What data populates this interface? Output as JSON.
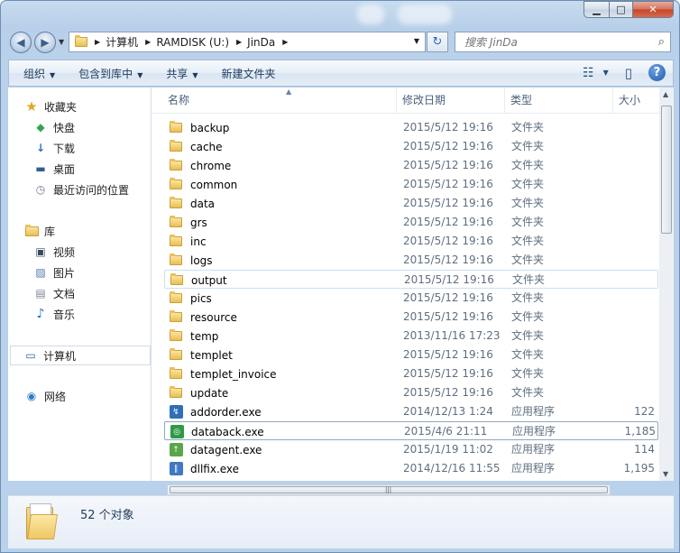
{
  "window": {
    "min_symbol": "▁",
    "max_symbol": "□",
    "close_symbol": "✕"
  },
  "nav": {
    "back_symbol": "◀",
    "forward_symbol": "▶",
    "drop_symbol": "▼",
    "breadcrumb": [
      "计算机",
      "RAMDISK (U:)",
      "JinDa"
    ],
    "breadcrumb_sep": "▶",
    "refresh_symbol": "↻",
    "search_placeholder": "搜索 JinDa",
    "search_icon": "⌕"
  },
  "toolbar": {
    "organize": "组织",
    "include_in_library": "包含到库中",
    "share": "共享",
    "new_folder": "新建文件夹",
    "arrow": "▼",
    "view_icon": "☷",
    "pane_icon": "▯",
    "help": "?"
  },
  "sidebar": {
    "favorites": {
      "label": "收藏夹",
      "icon": "★",
      "items": [
        {
          "label": "快盘",
          "icon": "◆"
        },
        {
          "label": "下载",
          "icon": "↓"
        },
        {
          "label": "桌面",
          "icon": "▬"
        },
        {
          "label": "最近访问的位置",
          "icon": "◷"
        }
      ]
    },
    "libraries": {
      "label": "库",
      "items": [
        {
          "label": "视频",
          "icon": "▣"
        },
        {
          "label": "图片",
          "icon": "▨"
        },
        {
          "label": "文档",
          "icon": "▤"
        },
        {
          "label": "音乐",
          "icon": "♪"
        }
      ]
    },
    "computer": {
      "label": "计算机",
      "icon": "▭"
    },
    "network": {
      "label": "网络",
      "icon": "◉"
    }
  },
  "columns": {
    "name": "名称",
    "date": "修改日期",
    "type": "类型",
    "size": "大小",
    "sort_arrow": "▲"
  },
  "files": [
    {
      "name": "backup",
      "date": "2015/5/12 19:16",
      "type": "文件夹",
      "size": "",
      "kind": "folder"
    },
    {
      "name": "cache",
      "date": "2015/5/12 19:16",
      "type": "文件夹",
      "size": "",
      "kind": "folder"
    },
    {
      "name": "chrome",
      "date": "2015/5/12 19:16",
      "type": "文件夹",
      "size": "",
      "kind": "folder"
    },
    {
      "name": "common",
      "date": "2015/5/12 19:16",
      "type": "文件夹",
      "size": "",
      "kind": "folder"
    },
    {
      "name": "data",
      "date": "2015/5/12 19:16",
      "type": "文件夹",
      "size": "",
      "kind": "folder"
    },
    {
      "name": "grs",
      "date": "2015/5/12 19:16",
      "type": "文件夹",
      "size": "",
      "kind": "folder"
    },
    {
      "name": "inc",
      "date": "2015/5/12 19:16",
      "type": "文件夹",
      "size": "",
      "kind": "folder"
    },
    {
      "name": "logs",
      "date": "2015/5/12 19:16",
      "type": "文件夹",
      "size": "",
      "kind": "folder"
    },
    {
      "name": "output",
      "date": "2015/5/12 19:16",
      "type": "文件夹",
      "size": "",
      "kind": "folder",
      "state": "hl"
    },
    {
      "name": "pics",
      "date": "2015/5/12 19:16",
      "type": "文件夹",
      "size": "",
      "kind": "folder"
    },
    {
      "name": "resource",
      "date": "2015/5/12 19:16",
      "type": "文件夹",
      "size": "",
      "kind": "folder"
    },
    {
      "name": "temp",
      "date": "2013/11/16 17:23",
      "type": "文件夹",
      "size": "",
      "kind": "folder"
    },
    {
      "name": "templet",
      "date": "2015/5/12 19:16",
      "type": "文件夹",
      "size": "",
      "kind": "folder"
    },
    {
      "name": "templet_invoice",
      "date": "2015/5/12 19:16",
      "type": "文件夹",
      "size": "",
      "kind": "folder"
    },
    {
      "name": "update",
      "date": "2015/5/12 19:16",
      "type": "文件夹",
      "size": "",
      "kind": "folder"
    },
    {
      "name": "addorder.exe",
      "date": "2014/12/13 1:24",
      "type": "应用程序",
      "size": "122",
      "kind": "exe",
      "color": "#2f6fb7",
      "glyph": "↯"
    },
    {
      "name": "databack.exe",
      "date": "2015/4/6 21:11",
      "type": "应用程序",
      "size": "1,185",
      "kind": "exe",
      "color": "#2f9a45",
      "glyph": "◎",
      "state": "sel"
    },
    {
      "name": "datagent.exe",
      "date": "2015/1/19 11:02",
      "type": "应用程序",
      "size": "114",
      "kind": "exe",
      "color": "#5aa64a",
      "glyph": "↑"
    },
    {
      "name": "dllfix.exe",
      "date": "2014/12/16 11:55",
      "type": "应用程序",
      "size": "1,195",
      "kind": "exe",
      "color": "#3f78c4",
      "glyph": "∥"
    }
  ],
  "scroll": {
    "up": "▲",
    "down": "▼",
    "left": "◀",
    "right": "▶",
    "grip": "|||"
  },
  "status": {
    "count": "52 个对象"
  }
}
